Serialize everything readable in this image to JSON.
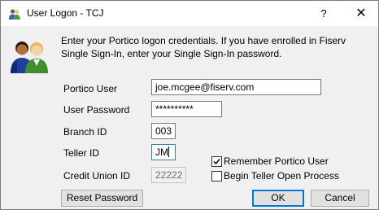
{
  "window": {
    "title": "User Logon - TCJ",
    "help_glyph": "?",
    "close_glyph": "✕"
  },
  "instructions": "Enter your Portico logon credentials. If you have enrolled in Fiserv Single Sign-In, enter your Single Sign-In password.",
  "fields": {
    "portico_user": {
      "label": "Portico User",
      "value": "joe.mcgee@fiserv.com"
    },
    "user_password": {
      "label": "User Password",
      "value": "**********"
    },
    "branch_id": {
      "label": "Branch ID",
      "value": "003"
    },
    "teller_id": {
      "label": "Teller ID",
      "value": "JM"
    },
    "credit_union_id": {
      "label": "Credit Union ID",
      "value": "22222"
    }
  },
  "options": {
    "remember_user": {
      "label": "Remember Portico User",
      "checked": true
    },
    "begin_teller_open": {
      "label": "Begin Teller Open Process",
      "checked": false
    }
  },
  "buttons": {
    "reset_password": "Reset Password",
    "ok": "OK",
    "cancel": "Cancel"
  },
  "icons": {
    "title": "users-icon",
    "header": "users-icon",
    "check": "checkmark-icon"
  },
  "colors": {
    "accent": "#0078d7",
    "focus_border": "#3c7fb1",
    "dialog_bg": "#f0f0f0",
    "checkmark": "#000000"
  }
}
